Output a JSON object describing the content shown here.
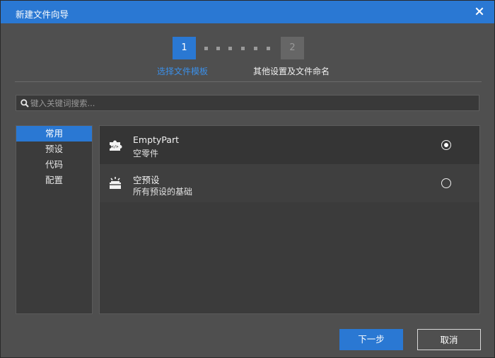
{
  "window": {
    "title": "新建文件向导"
  },
  "steps": [
    {
      "number": "1",
      "label": "选择文件模板",
      "active": true
    },
    {
      "number": "2",
      "label": "其他设置及文件命名",
      "active": false
    }
  ],
  "search": {
    "placeholder": "键入关键词搜索..."
  },
  "sidebar": {
    "items": [
      {
        "label": "常用",
        "active": true
      },
      {
        "label": "预设",
        "active": false
      },
      {
        "label": "代码",
        "active": false
      },
      {
        "label": "配置",
        "active": false
      }
    ]
  },
  "templates": [
    {
      "title": "EmptyPart",
      "subtitle": "空零件",
      "icon": "puzzle-code-icon",
      "selected": true
    },
    {
      "title": "空预设",
      "subtitle": "所有预设的基础",
      "icon": "preset-box-icon",
      "selected": false
    }
  ],
  "buttons": {
    "next": "下一步",
    "cancel": "取消"
  },
  "colors": {
    "accent": "#2a78d3",
    "accent_text": "#3b8fe8",
    "background": "#4f4f4f"
  }
}
